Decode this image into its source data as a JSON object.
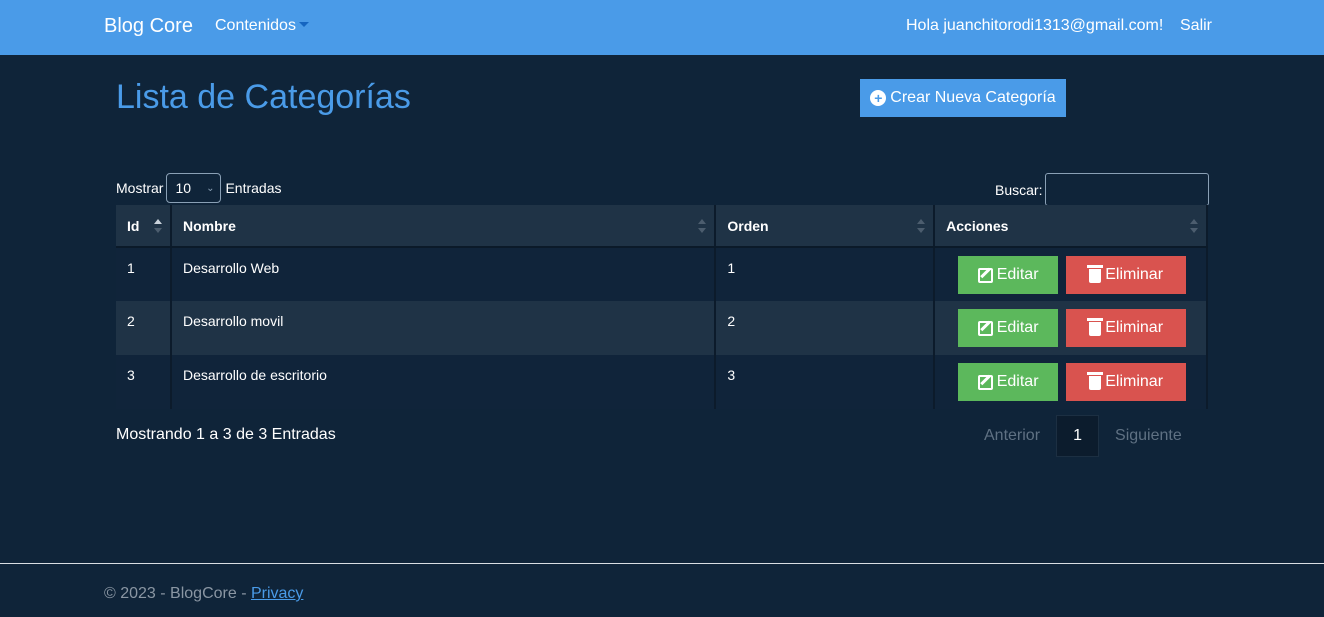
{
  "navbar": {
    "brand": "Blog Core",
    "menu_label": "Contenidos",
    "greeting": "Hola juanchitorodi1313@gmail.com!",
    "logout": "Salir"
  },
  "header": {
    "title": "Lista de Categorías",
    "create_button": "Crear Nueva Categoría"
  },
  "table_controls": {
    "show_label": "Mostrar",
    "page_size": "10",
    "entries_label": "Entradas",
    "search_label": "Buscar:",
    "search_value": ""
  },
  "table": {
    "columns": [
      "Id",
      "Nombre",
      "Orden",
      "Acciones"
    ],
    "rows": [
      {
        "id": "1",
        "nombre": "Desarrollo Web",
        "orden": "1"
      },
      {
        "id": "2",
        "nombre": "Desarrollo movil",
        "orden": "2"
      },
      {
        "id": "3",
        "nombre": "Desarrollo de escritorio",
        "orden": "3"
      }
    ],
    "edit_label": "Editar",
    "delete_label": "Eliminar"
  },
  "pagination": {
    "info": "Mostrando 1 a 3 de 3 Entradas",
    "prev": "Anterior",
    "current": "1",
    "next": "Siguiente"
  },
  "footer": {
    "text": "© 2023 - BlogCore - ",
    "privacy_link": "Privacy"
  },
  "colors": {
    "navbar": "#4a9be8",
    "background": "#0f2439",
    "edit": "#5cb85c",
    "delete": "#d9534f"
  }
}
